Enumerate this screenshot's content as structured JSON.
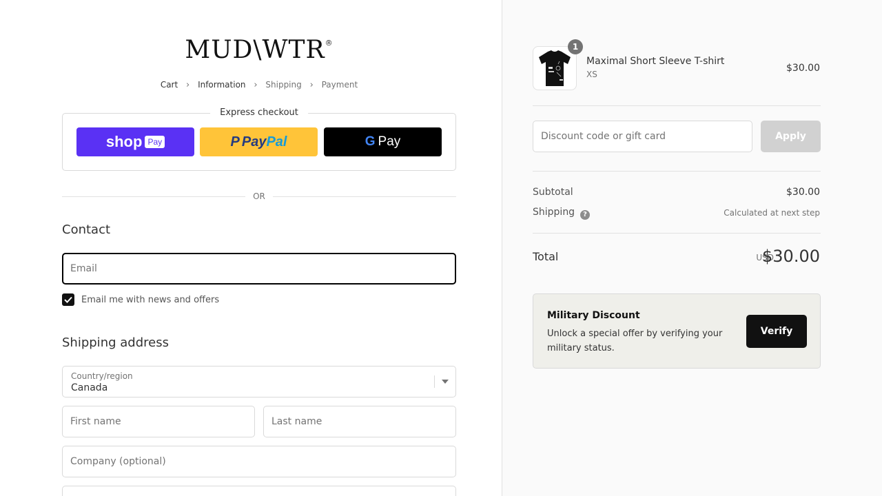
{
  "brand": {
    "logo_text": "MUD\\WTR",
    "logo_mark": "®"
  },
  "breadcrumb": {
    "items": [
      "Cart",
      "Information",
      "Shipping",
      "Payment"
    ],
    "active_index": 1
  },
  "express": {
    "title": "Express checkout",
    "shop_pay": {
      "shop": "shop",
      "pay": "Pay"
    },
    "paypal": {
      "pay": "Pay",
      "pal": "Pal"
    },
    "gpay": {
      "g": "G",
      "pay": "Pay"
    }
  },
  "divider_or": "OR",
  "contact": {
    "heading": "Contact",
    "email_placeholder": "Email",
    "newsletter_label": "Email me with news and offers",
    "newsletter_checked": true
  },
  "shipping_address": {
    "heading": "Shipping address",
    "country_label": "Country/region",
    "country_value": "Canada",
    "first_name_placeholder": "First name",
    "last_name_placeholder": "Last name",
    "company_placeholder": "Company (optional)"
  },
  "order": {
    "item": {
      "name": "Maximal Short Sleeve T-shirt",
      "variant": "XS",
      "price": "$30.00",
      "quantity": "1"
    },
    "discount_placeholder": "Discount code or gift card",
    "apply_label": "Apply",
    "subtotal_label": "Subtotal",
    "subtotal_value": "$30.00",
    "shipping_label": "Shipping",
    "shipping_value": "Calculated at next step",
    "total_label": "Total",
    "total_currency": "USD",
    "total_value": "$30.00"
  },
  "military": {
    "title": "Military Discount",
    "description": "Unlock a special offer by verifying your military status.",
    "button_label": "Verify"
  },
  "colors": {
    "shop_pay": "#5a31f4",
    "paypal": "#ffc439",
    "gpay": "#000000",
    "focus_border": "#000000",
    "sidebar_bg": "#fafafa",
    "military_bg": "#efefea"
  }
}
